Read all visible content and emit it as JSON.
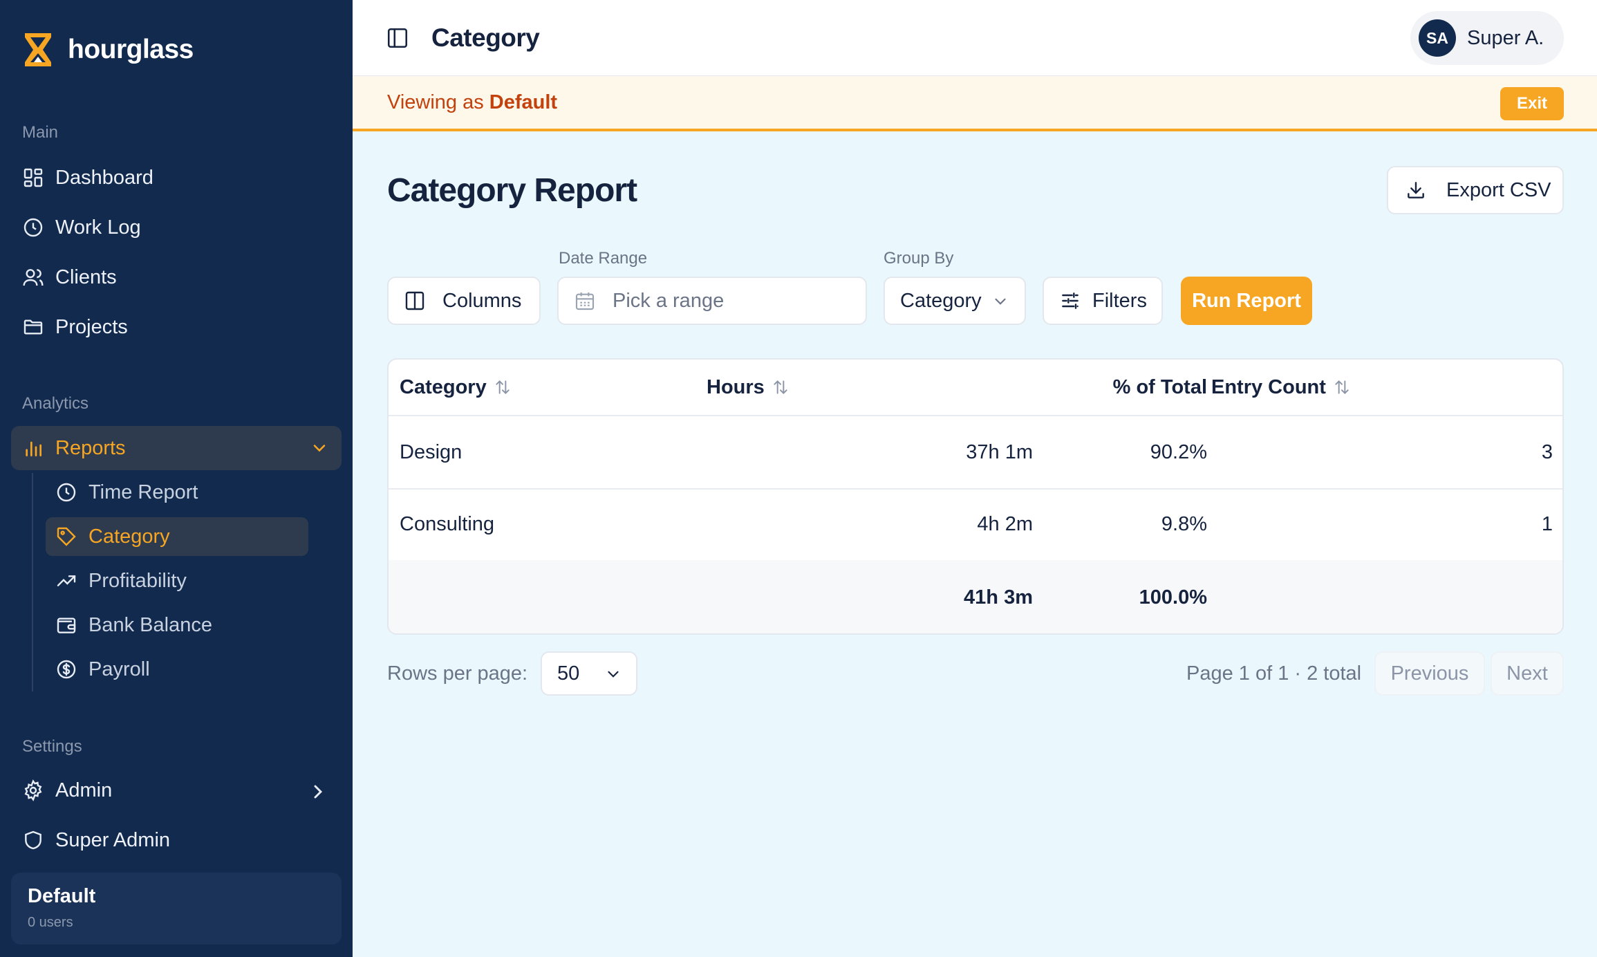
{
  "brand": {
    "name": "hourglass"
  },
  "sidebar": {
    "sections": {
      "main": "Main",
      "analytics": "Analytics",
      "settings": "Settings"
    },
    "main_items": [
      {
        "label": "Dashboard",
        "icon": "dashboard-icon"
      },
      {
        "label": "Work Log",
        "icon": "clock-icon"
      },
      {
        "label": "Clients",
        "icon": "users-icon"
      },
      {
        "label": "Projects",
        "icon": "folder-icon"
      }
    ],
    "reports": {
      "label": "Reports",
      "icon": "bar-chart-icon",
      "expanded": true
    },
    "report_items": [
      {
        "label": "Time Report",
        "icon": "clock-icon"
      },
      {
        "label": "Category",
        "icon": "tag-icon",
        "active": true
      },
      {
        "label": "Profitability",
        "icon": "trending-up-icon"
      },
      {
        "label": "Bank Balance",
        "icon": "wallet-icon"
      },
      {
        "label": "Payroll",
        "icon": "dollar-circle-icon"
      }
    ],
    "settings_items": [
      {
        "label": "Admin",
        "icon": "gear-icon"
      },
      {
        "label": "Super Admin",
        "icon": "shield-icon"
      }
    ],
    "org": {
      "name": "Default",
      "users": "0 users"
    }
  },
  "header": {
    "title": "Category",
    "user": {
      "initials": "SA",
      "name": "Super A."
    }
  },
  "banner": {
    "prefix": "Viewing as",
    "org": "Default",
    "exit_label": "Exit"
  },
  "report": {
    "title": "Category Report",
    "export_label": "Export CSV",
    "columns_label": "Columns",
    "date_range_label": "Date Range",
    "date_range_placeholder": "Pick a range",
    "group_by_label": "Group By",
    "group_by_value": "Category",
    "filters_label": "Filters",
    "run_label": "Run Report"
  },
  "table": {
    "headers": [
      "Category",
      "Hours",
      "% of Total",
      "Entry Count"
    ],
    "rows": [
      {
        "category": "Design",
        "hours": "37h 1m",
        "pct": "90.2%",
        "count": "3"
      },
      {
        "category": "Consulting",
        "hours": "4h 2m",
        "pct": "9.8%",
        "count": "1"
      }
    ],
    "totals": {
      "hours": "41h 3m",
      "pct": "100.0%"
    }
  },
  "pagination": {
    "rows_label": "Rows per page:",
    "rows_value": "50",
    "page_info": "Page 1 of 1 · 2 total",
    "prev_label": "Previous",
    "next_label": "Next"
  },
  "colors": {
    "accent": "#f6a623",
    "sidebar": "#122a4e",
    "background": "#eaf7fc"
  }
}
